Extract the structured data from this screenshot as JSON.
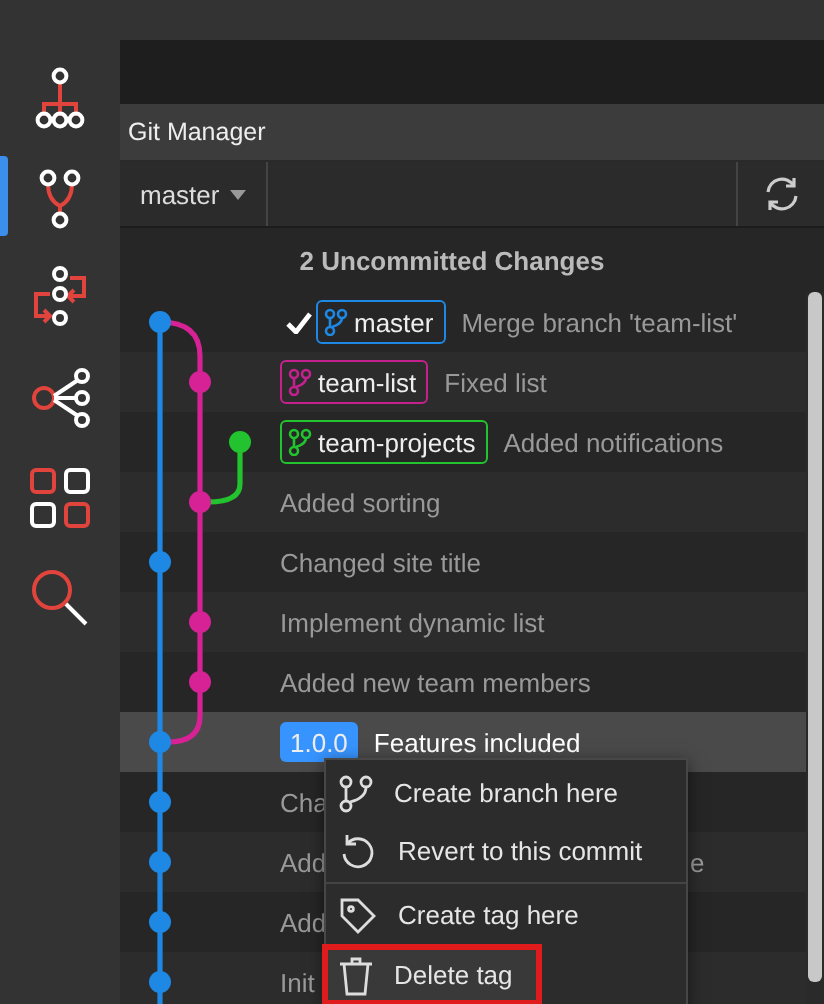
{
  "sidebar": [
    {
      "kind": "tree",
      "selected": false
    },
    {
      "kind": "branch",
      "selected": true
    },
    {
      "kind": "flow",
      "selected": false
    },
    {
      "kind": "share",
      "selected": false
    },
    {
      "kind": "grid",
      "selected": false
    },
    {
      "kind": "search",
      "selected": false
    }
  ],
  "panel": {
    "title": "Git Manager",
    "branch": "master",
    "uncommitted": "2 Uncommitted Changes"
  },
  "commits": [
    {
      "refs": [
        {
          "kind": "branch",
          "name": "master",
          "color": "#1e88e5"
        }
      ],
      "current": true,
      "message": "Merge branch 'team-list'",
      "selected": false
    },
    {
      "refs": [
        {
          "kind": "branch",
          "name": "team-list",
          "color": "#c4218f"
        }
      ],
      "current": false,
      "message": "Fixed list",
      "selected": false
    },
    {
      "refs": [
        {
          "kind": "branch",
          "name": "team-projects",
          "color": "#22c32e"
        }
      ],
      "current": false,
      "message": "Added notifications",
      "selected": false
    },
    {
      "current": false,
      "message": "Added sorting",
      "selected": false
    },
    {
      "current": false,
      "message": "Changed site title",
      "selected": false
    },
    {
      "current": false,
      "message": "Implement dynamic list",
      "selected": false
    },
    {
      "current": false,
      "message": "Added new team members",
      "selected": false
    },
    {
      "refs": [
        {
          "kind": "tag",
          "name": "1.0.0",
          "color": "#3794ff"
        }
      ],
      "current": false,
      "message": "Features included",
      "selected": true
    },
    {
      "current": false,
      "message": "Cha",
      "selected": false
    },
    {
      "current": false,
      "message": "Add",
      "tail": "e",
      "selected": false
    },
    {
      "current": false,
      "message": "Add",
      "selected": false
    },
    {
      "current": false,
      "message": "Init",
      "selected": false
    }
  ],
  "context_menu": [
    {
      "kind": "branch",
      "label": "Create branch here",
      "highlighted": false
    },
    {
      "kind": "revert",
      "label": "Revert to this commit",
      "highlighted": false
    },
    {
      "kind": "tag",
      "label": "Create tag here",
      "highlighted": false
    },
    {
      "kind": "delete",
      "label": "Delete tag",
      "highlighted": true
    }
  ]
}
